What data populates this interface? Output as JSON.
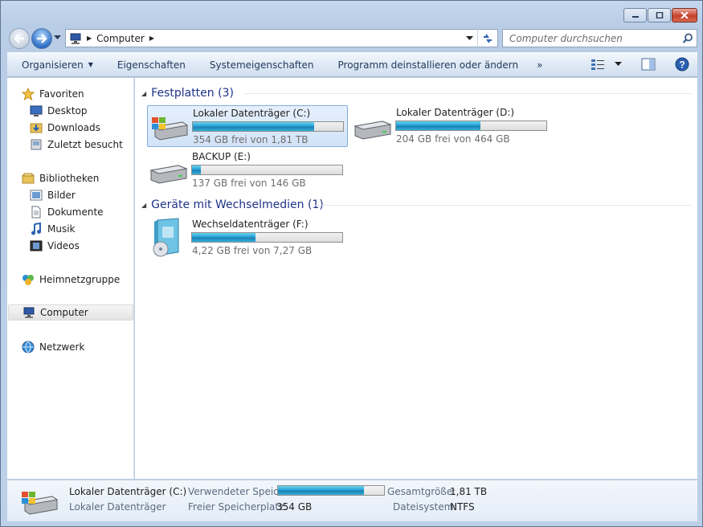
{
  "window": {
    "title": "Computer",
    "buttons": {
      "minimize_icon": "minimize-icon",
      "maximize_icon": "maximize-icon",
      "close_icon": "close-icon"
    }
  },
  "address_bar": {
    "breadcrumb": "Computer",
    "search_placeholder": "Computer durchsuchen"
  },
  "command_bar": {
    "items": [
      {
        "label": "Organisieren",
        "has_dropdown": true
      },
      {
        "label": "Eigenschaften"
      },
      {
        "label": "Systemeigenschaften"
      },
      {
        "label": "Programm deinstallieren oder ändern"
      }
    ],
    "overflow": "»"
  },
  "nav_pane": {
    "favorites": {
      "label": "Favoriten",
      "items": [
        "Desktop",
        "Downloads",
        "Zuletzt besucht"
      ]
    },
    "libraries": {
      "label": "Bibliotheken",
      "items": [
        "Bilder",
        "Dokumente",
        "Musik",
        "Videos"
      ]
    },
    "homegroup": "Heimnetzgruppe",
    "computer": "Computer",
    "network": "Netzwerk"
  },
  "groups": [
    {
      "header": "Festplatten (3)",
      "drives": [
        {
          "name": "Lokaler Datenträger (C:)",
          "free": "354 GB frei von 1,81 TB",
          "used_fraction": 0.81,
          "selected": true
        },
        {
          "name": "Lokaler Datenträger (D:)",
          "free": "204 GB frei von 464 GB",
          "used_fraction": 0.56,
          "selected": false
        },
        {
          "name": "BACKUP (E:)",
          "free": "137 GB frei von 146 GB",
          "used_fraction": 0.06,
          "selected": false
        }
      ]
    },
    {
      "header": "Geräte mit Wechselmedien (1)",
      "drives": [
        {
          "name": "Wechseldatenträger (F:)",
          "free": "4,22 GB frei von 7,27 GB",
          "used_fraction": 0.42,
          "selected": false
        }
      ]
    }
  ],
  "details": {
    "name": "Lokaler Datenträger (C:)",
    "type": "Lokaler Datenträger",
    "used_label": "Verwendeter Speic...",
    "used_fraction": 0.81,
    "free_label": "Freier Speicherplatz:",
    "free_value": "354 GB",
    "total_label": "Gesamtgröße:",
    "total_value": "1,81 TB",
    "fs_label": "Dateisystem:",
    "fs_value": "NTFS"
  },
  "colors": {
    "accent_text": "#1e3287",
    "progress": "#26a0da",
    "selection_bg": "#d2e3f8"
  }
}
